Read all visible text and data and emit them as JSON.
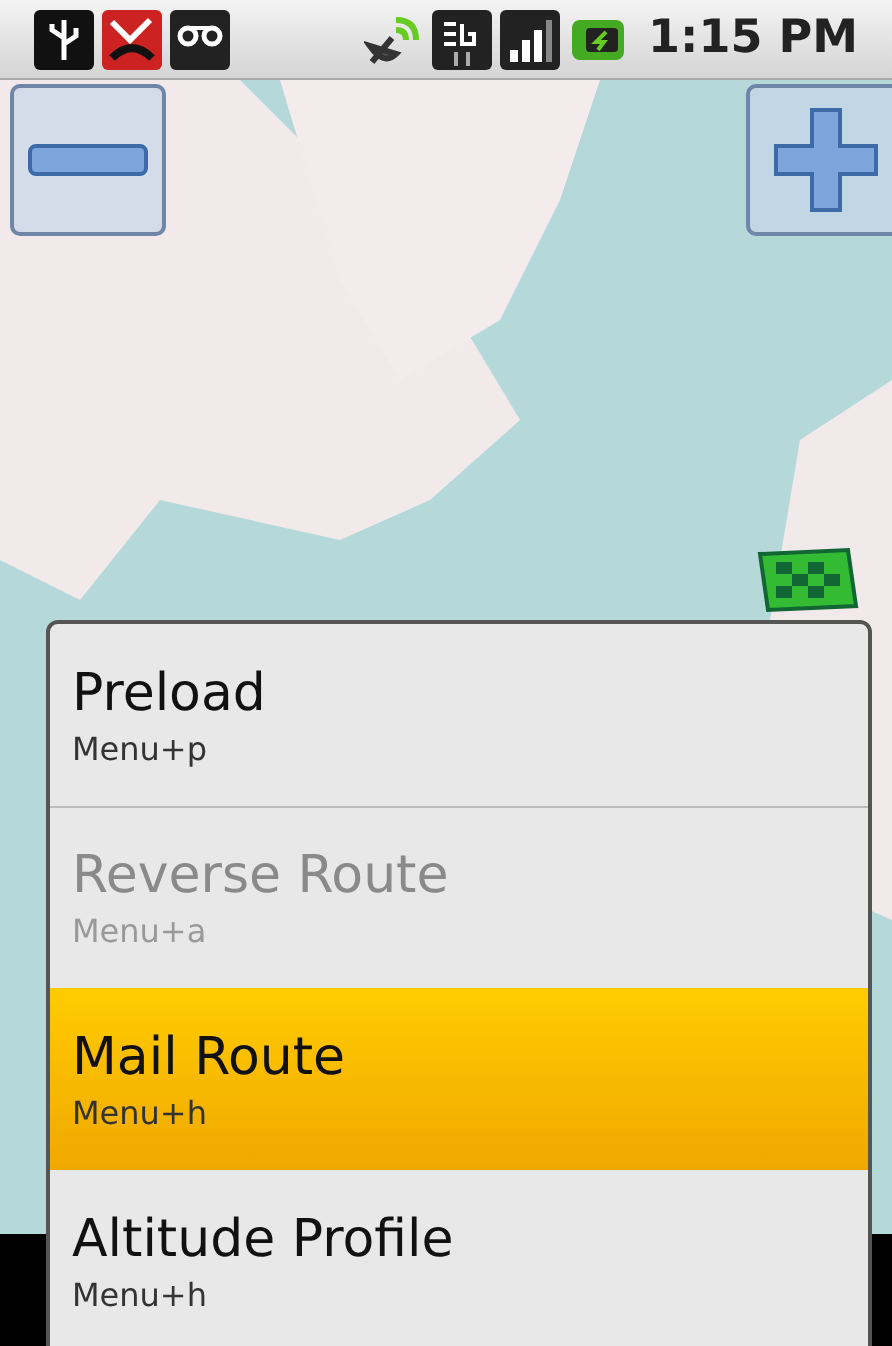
{
  "status_bar": {
    "time": "1:15 PM"
  },
  "menu": {
    "items": [
      {
        "label": "Preload",
        "shortcut": "Menu+p",
        "disabled": false,
        "selected": false
      },
      {
        "label": "Reverse Route",
        "shortcut": "Menu+a",
        "disabled": true,
        "selected": false
      },
      {
        "label": "Mail Route",
        "shortcut": "Menu+h",
        "disabled": false,
        "selected": true
      },
      {
        "label": "Altitude Profile",
        "shortcut": "Menu+h",
        "disabled": false,
        "selected": false
      }
    ]
  }
}
